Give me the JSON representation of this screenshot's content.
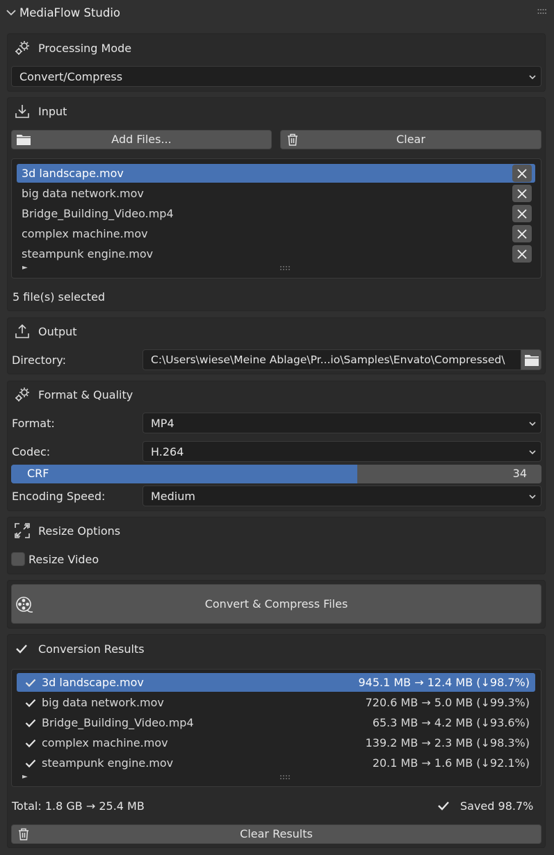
{
  "app": {
    "title": "MediaFlow Studio"
  },
  "processing_mode": {
    "header": "Processing Mode",
    "selected": "Convert/Compress"
  },
  "input": {
    "header": "Input",
    "add_files_label": "Add Files...",
    "clear_label": "Clear",
    "files": [
      "3d landscape.mov",
      "big data network.mov",
      "Bridge_Building_Video.mp4",
      "complex machine.mov",
      "steampunk engine.mov"
    ],
    "selected_index": 0,
    "status": "5 file(s) selected"
  },
  "output": {
    "header": "Output",
    "directory_label": "Directory:",
    "directory_value": "C:\\Users\\wiese\\Meine Ablage\\Pr...io\\Samples\\Envato\\Compressed\\"
  },
  "format_quality": {
    "header": "Format & Quality",
    "format_label": "Format:",
    "format_value": "MP4",
    "codec_label": "Codec:",
    "codec_value": "H.264",
    "crf_label": "CRF",
    "crf_value": "34",
    "crf_fraction": 0.653,
    "speed_label": "Encoding Speed:",
    "speed_value": "Medium"
  },
  "resize": {
    "header": "Resize Options",
    "checkbox_label": "Resize Video",
    "checked": false
  },
  "convert_button_label": "Convert & Compress Files",
  "results": {
    "header": "Conversion Results",
    "rows": [
      {
        "name": "3d landscape.mov",
        "result": "945.1 MB → 12.4 MB (↓98.7%)"
      },
      {
        "name": "big data network.mov",
        "result": "720.6 MB → 5.0 MB (↓99.3%)"
      },
      {
        "name": "Bridge_Building_Video.mp4",
        "result": "65.3 MB → 4.2 MB (↓93.6%)"
      },
      {
        "name": "complex machine.mov",
        "result": "139.2 MB → 2.3 MB (↓98.3%)"
      },
      {
        "name": "steampunk engine.mov",
        "result": "20.1 MB → 1.6 MB (↓92.1%)"
      }
    ],
    "total": "Total: 1.8 GB → 25.4 MB",
    "saved": "Saved 98.7%",
    "clear_label": "Clear Results"
  },
  "colors": {
    "accent": "#4772b3",
    "background": "#303030",
    "panel": "#2a2a2a",
    "button": "#545454"
  }
}
